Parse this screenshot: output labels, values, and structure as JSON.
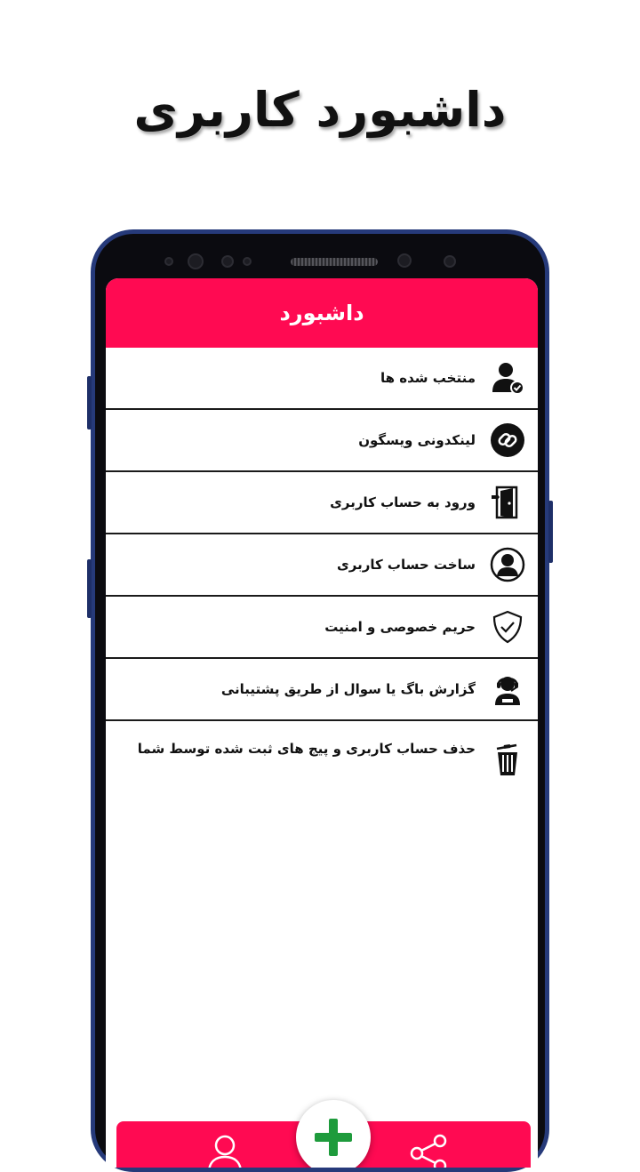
{
  "promo": {
    "title": "داشبورد کاربری"
  },
  "app": {
    "header_title": "داشبورد",
    "accent": "#ff0a52",
    "fab_color": "#1e9b3c"
  },
  "menu": [
    {
      "label": "منتخب شده ها",
      "icon": "user-check-icon"
    },
    {
      "label": "لینکدونی ویسگون",
      "icon": "link-icon"
    },
    {
      "label": "ورود به حساب کاربری",
      "icon": "door-login-icon"
    },
    {
      "label": "ساخت حساب کاربری",
      "icon": "user-circle-icon"
    },
    {
      "label": "حریم خصوصی و امنیت",
      "icon": "shield-check-icon"
    },
    {
      "label": "گزارش باگ یا سوال از طریق پشتیبانی",
      "icon": "support-headset-icon"
    },
    {
      "label": "حذف حساب کاربری و پیج های ثبت شده توسط شما",
      "icon": "trash-icon"
    }
  ],
  "bottom_nav": {
    "left": "user-outline-icon",
    "center": "plus-icon",
    "right": "share-icon"
  }
}
